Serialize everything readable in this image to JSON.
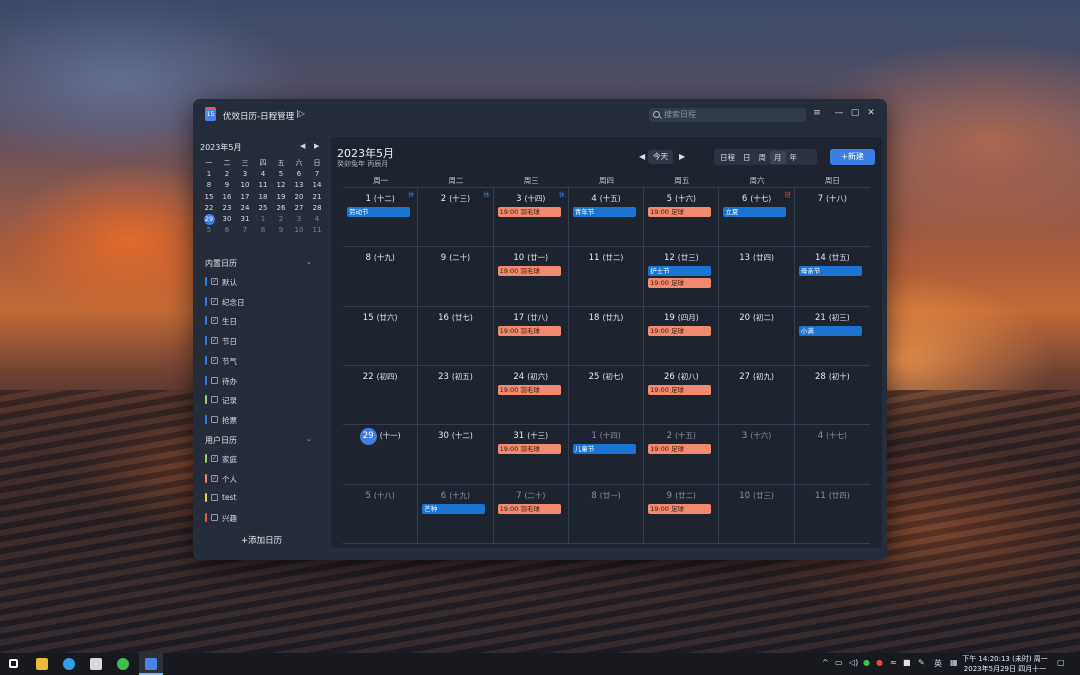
{
  "window": {
    "title": "优效日历-日程管理",
    "search_placeholder": "搜索日程",
    "sidebar_toggle_icon": "sidebar-toggle-icon",
    "controls": [
      "≡",
      "—",
      "▢",
      "✕"
    ]
  },
  "mini_calendar": {
    "header": "2023年5月",
    "weekdays": [
      "一",
      "二",
      "三",
      "四",
      "五",
      "六",
      "日"
    ],
    "weeks": [
      [
        {
          "d": "1"
        },
        {
          "d": "2"
        },
        {
          "d": "3"
        },
        {
          "d": "4"
        },
        {
          "d": "5"
        },
        {
          "d": "6"
        },
        {
          "d": "7"
        }
      ],
      [
        {
          "d": "8"
        },
        {
          "d": "9"
        },
        {
          "d": "10"
        },
        {
          "d": "11"
        },
        {
          "d": "12"
        },
        {
          "d": "13"
        },
        {
          "d": "14"
        }
      ],
      [
        {
          "d": "15"
        },
        {
          "d": "16"
        },
        {
          "d": "17"
        },
        {
          "d": "18"
        },
        {
          "d": "19"
        },
        {
          "d": "20"
        },
        {
          "d": "21"
        }
      ],
      [
        {
          "d": "22"
        },
        {
          "d": "23"
        },
        {
          "d": "24"
        },
        {
          "d": "25"
        },
        {
          "d": "26"
        },
        {
          "d": "27"
        },
        {
          "d": "28"
        }
      ],
      [
        {
          "d": "29",
          "today": true
        },
        {
          "d": "30"
        },
        {
          "d": "31"
        },
        {
          "d": "1",
          "dim": true
        },
        {
          "d": "2",
          "dim": true
        },
        {
          "d": "3",
          "dim": true
        },
        {
          "d": "4",
          "dim": true
        }
      ],
      [
        {
          "d": "5",
          "dim": true
        },
        {
          "d": "6",
          "dim": true
        },
        {
          "d": "7",
          "dim": true
        },
        {
          "d": "8",
          "dim": true
        },
        {
          "d": "9",
          "dim": true
        },
        {
          "d": "10",
          "dim": true
        },
        {
          "d": "11",
          "dim": true
        }
      ]
    ]
  },
  "builtin_calendars": {
    "title": "内置日历",
    "items": [
      {
        "label": "默认",
        "color": "#2f7ee8",
        "checked": true
      },
      {
        "label": "纪念日",
        "color": "#2f7ee8",
        "checked": true
      },
      {
        "label": "生日",
        "color": "#2f7ee8",
        "checked": true
      },
      {
        "label": "节日",
        "color": "#2f7ee8",
        "checked": true
      },
      {
        "label": "节气",
        "color": "#2f7ee8",
        "checked": true
      },
      {
        "label": "待办",
        "color": "#2f7ee8",
        "checked": false
      },
      {
        "label": "记录",
        "color": "#9bd46a",
        "checked": false
      },
      {
        "label": "抢票",
        "color": "#2f7ee8",
        "checked": false
      }
    ]
  },
  "user_calendars": {
    "title": "用户日历",
    "items": [
      {
        "label": "家庭",
        "color": "#8fd36a",
        "checked": true
      },
      {
        "label": "个人",
        "color": "#f0886d",
        "checked": true
      },
      {
        "label": "test",
        "color": "#e6d24a",
        "checked": false
      },
      {
        "label": "兴趣",
        "color": "#e8583f",
        "checked": false
      }
    ]
  },
  "add_calendar_label": "+添加日历",
  "main": {
    "month_title": "2023年5月",
    "subtitle": "癸卯兔年 丙辰月",
    "today_label": "今天",
    "views": [
      "日程",
      "日",
      "周",
      "月",
      "年"
    ],
    "active_view": "月",
    "new_label": "+新建",
    "weekdays": [
      "周一",
      "周二",
      "周三",
      "周四",
      "周五",
      "周六",
      "周日"
    ]
  },
  "month_grid": [
    [
      {
        "day": "1",
        "lunar": "(十二)",
        "badge": "休",
        "events": [
          {
            "t": "劳动节",
            "c": "blue"
          }
        ]
      },
      {
        "day": "2",
        "lunar": "(十三)",
        "badge": "休",
        "events": []
      },
      {
        "day": "3",
        "lunar": "(十四)",
        "badge": "休",
        "events": [
          {
            "t": "19:00 羽毛球",
            "c": "orange"
          }
        ]
      },
      {
        "day": "4",
        "lunar": "(十五)",
        "events": [
          {
            "t": "青年节",
            "c": "blue"
          }
        ]
      },
      {
        "day": "5",
        "lunar": "(十六)",
        "events": [
          {
            "t": "19:00 足球",
            "c": "orange"
          }
        ]
      },
      {
        "day": "6",
        "lunar": "(十七)",
        "badge": "班",
        "badge_type": "work",
        "events": [
          {
            "t": "立夏",
            "c": "blue"
          }
        ]
      },
      {
        "day": "7",
        "lunar": "(十八)",
        "events": []
      }
    ],
    [
      {
        "day": "8",
        "lunar": "(十九)",
        "events": []
      },
      {
        "day": "9",
        "lunar": "(二十)",
        "events": []
      },
      {
        "day": "10",
        "lunar": "(廿一)",
        "events": [
          {
            "t": "19:00 羽毛球",
            "c": "orange"
          }
        ]
      },
      {
        "day": "11",
        "lunar": "(廿二)",
        "events": []
      },
      {
        "day": "12",
        "lunar": "(廿三)",
        "events": [
          {
            "t": "护士节",
            "c": "blue"
          },
          {
            "t": "19:00 足球",
            "c": "orange"
          }
        ]
      },
      {
        "day": "13",
        "lunar": "(廿四)",
        "events": []
      },
      {
        "day": "14",
        "lunar": "(廿五)",
        "events": [
          {
            "t": "母亲节",
            "c": "blue"
          }
        ]
      }
    ],
    [
      {
        "day": "15",
        "lunar": "(廿六)",
        "events": []
      },
      {
        "day": "16",
        "lunar": "(廿七)",
        "events": []
      },
      {
        "day": "17",
        "lunar": "(廿八)",
        "events": [
          {
            "t": "19:00 羽毛球",
            "c": "orange"
          }
        ]
      },
      {
        "day": "18",
        "lunar": "(廿九)",
        "events": []
      },
      {
        "day": "19",
        "lunar": "(四月)",
        "events": [
          {
            "t": "19:00 足球",
            "c": "orange"
          }
        ]
      },
      {
        "day": "20",
        "lunar": "(初二)",
        "events": []
      },
      {
        "day": "21",
        "lunar": "(初三)",
        "events": [
          {
            "t": "小满",
            "c": "blue"
          }
        ]
      }
    ],
    [
      {
        "day": "22",
        "lunar": "(初四)",
        "events": []
      },
      {
        "day": "23",
        "lunar": "(初五)",
        "events": []
      },
      {
        "day": "24",
        "lunar": "(初六)",
        "events": [
          {
            "t": "19:00 羽毛球",
            "c": "orange"
          }
        ]
      },
      {
        "day": "25",
        "lunar": "(初七)",
        "events": []
      },
      {
        "day": "26",
        "lunar": "(初八)",
        "events": [
          {
            "t": "19:00 足球",
            "c": "orange"
          }
        ]
      },
      {
        "day": "27",
        "lunar": "(初九)",
        "events": []
      },
      {
        "day": "28",
        "lunar": "(初十)",
        "events": []
      }
    ],
    [
      {
        "day": "29",
        "lunar": "(十一)",
        "today": true,
        "events": []
      },
      {
        "day": "30",
        "lunar": "(十二)",
        "events": []
      },
      {
        "day": "31",
        "lunar": "(十三)",
        "events": [
          {
            "t": "19:00 羽毛球",
            "c": "orange"
          }
        ]
      },
      {
        "day": "1",
        "lunar": "(十四)",
        "other": true,
        "events": [
          {
            "t": "儿童节",
            "c": "blue"
          }
        ]
      },
      {
        "day": "2",
        "lunar": "(十五)",
        "other": true,
        "events": [
          {
            "t": "19:00 足球",
            "c": "orange"
          }
        ]
      },
      {
        "day": "3",
        "lunar": "(十六)",
        "other": true,
        "events": []
      },
      {
        "day": "4",
        "lunar": "(十七)",
        "other": true,
        "events": []
      }
    ],
    [
      {
        "day": "5",
        "lunar": "(十八)",
        "other": true,
        "events": []
      },
      {
        "day": "6",
        "lunar": "(十九)",
        "other": true,
        "events": [
          {
            "t": "芒种",
            "c": "blue"
          }
        ]
      },
      {
        "day": "7",
        "lunar": "(二十)",
        "other": true,
        "events": [
          {
            "t": "19:00 羽毛球",
            "c": "orange"
          }
        ]
      },
      {
        "day": "8",
        "lunar": "(廿一)",
        "other": true,
        "events": []
      },
      {
        "day": "9",
        "lunar": "(廿二)",
        "other": true,
        "events": [
          {
            "t": "19:00 足球",
            "c": "orange"
          }
        ]
      },
      {
        "day": "10",
        "lunar": "(廿三)",
        "other": true,
        "events": []
      },
      {
        "day": "11",
        "lunar": "(廿四)",
        "other": true,
        "events": []
      }
    ]
  ],
  "taskbar": {
    "apps": [
      {
        "name": "start-icon",
        "color": "#ffffff"
      },
      {
        "name": "file-explorer-icon",
        "color": "#e8b93c"
      },
      {
        "name": "edge-browser-icon",
        "color": "#2fa0e6"
      },
      {
        "name": "game-app-icon",
        "color": "#d8d8d8"
      },
      {
        "name": "wechat-icon",
        "color": "#3cc24a"
      },
      {
        "name": "calendar-app-icon",
        "color": "#4d83e6"
      }
    ],
    "ime": "英",
    "clock_line1": "下午 14:20:13 (未时) 周一",
    "clock_line2": "2023年5月29日 四月十一"
  }
}
